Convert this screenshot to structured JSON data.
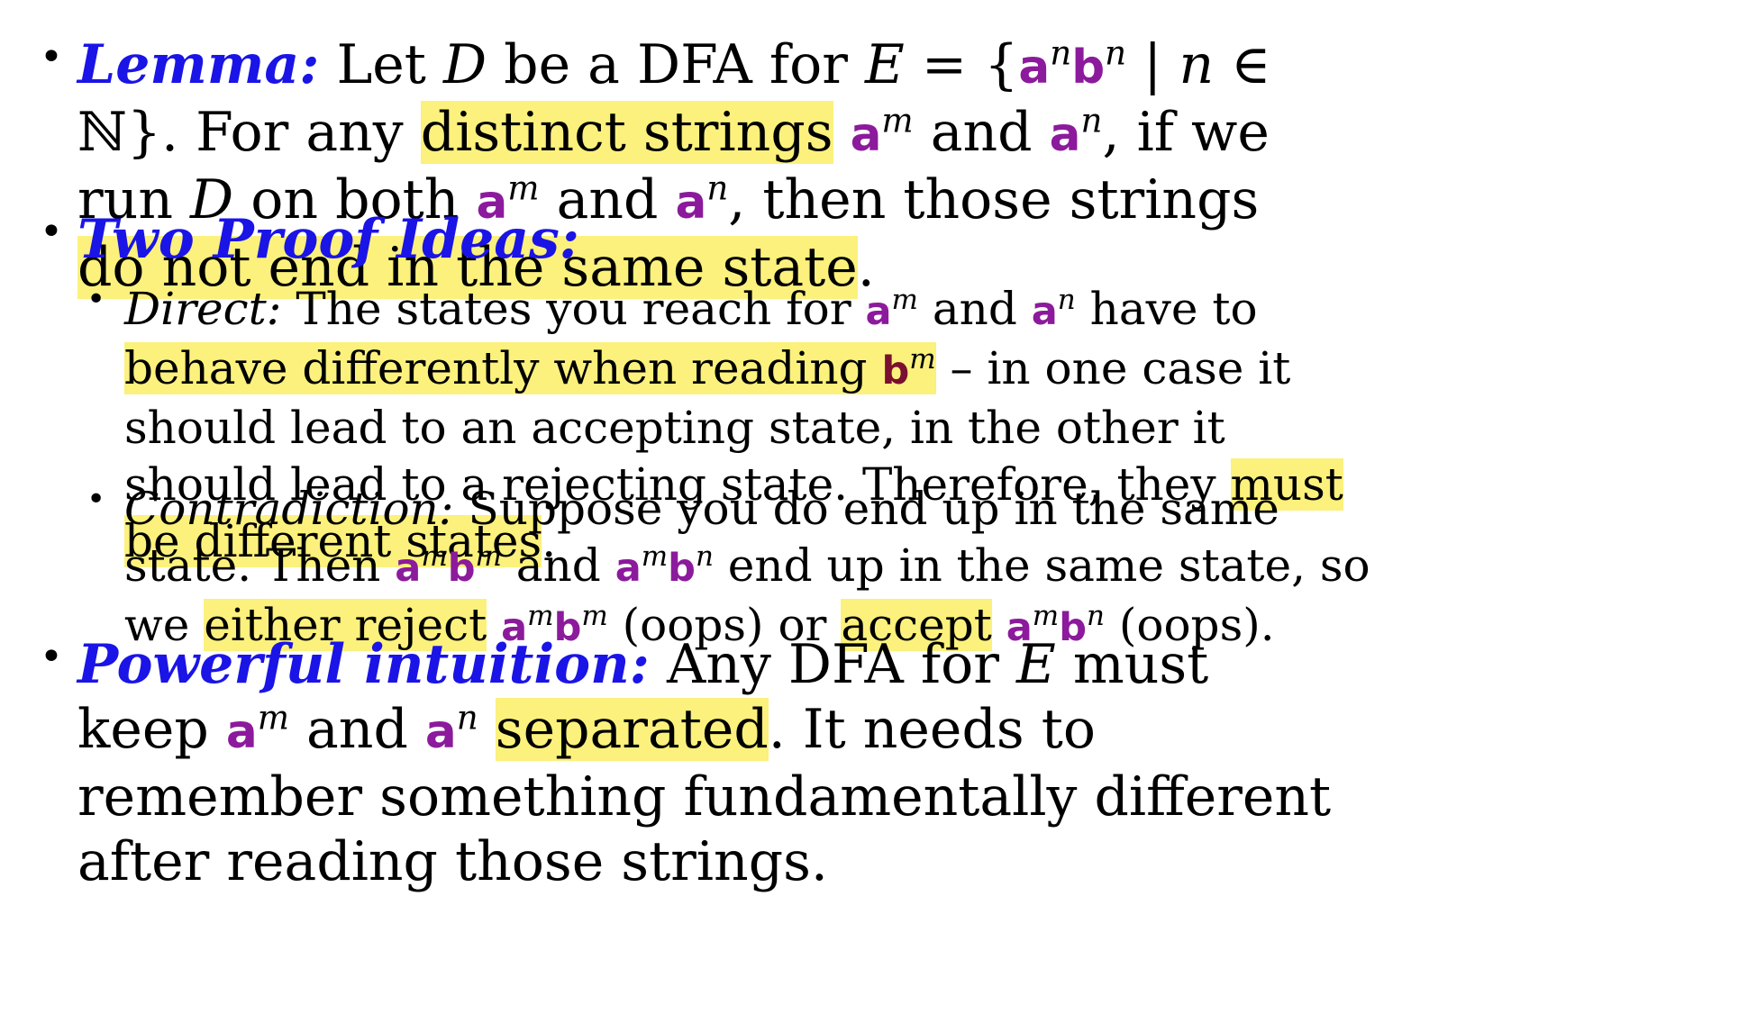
{
  "lemma": {
    "label": "Lemma:",
    "t1": "Let ",
    "D": "D",
    "t2": " be a DFA for ",
    "E": "E",
    "t3": " = {",
    "set_a": "a",
    "set_a_exp": "n",
    "set_b": "b",
    "set_b_exp": "n",
    "t4": " | ",
    "n": "n",
    "t5": " ∈ ℕ}. For any",
    "hl1": "distinct strings",
    "sp1": " ",
    "s1": "a",
    "s1_exp": "m",
    "t6": " and ",
    "s2": "a",
    "s2_exp": "n",
    "t7": ", if we run ",
    "D2": "D",
    "t8": " on both ",
    "s3": "a",
    "s3_exp": "m",
    "t9": " and ",
    "s4": "a",
    "s4_exp": "n",
    "t10": ", then those strings ",
    "hl2": "do not end in the same state",
    "t11": "."
  },
  "proof_ideas": {
    "label": "Two Proof Ideas:",
    "direct": {
      "label": "Direct:",
      "t1": " The states you reach for ",
      "s1": "a",
      "s1_exp": "m",
      "t2": " and ",
      "s2": "a",
      "s2_exp": "n",
      "t3": " have to",
      "hl1": " behave differently when reading ",
      "s3": "b",
      "s3_exp": "m",
      "t4": " – in one case it should lead to an accepting state, in the other it should lead to a rejecting state. Therefore, they ",
      "hl2": "must be different states",
      "t5": "."
    },
    "contradiction": {
      "label": "Contradiction:",
      "t1": " Suppose you do end up in the same state. Then ",
      "a1": "a",
      "a1_exp": "m",
      "b1": "b",
      "b1_exp": "m",
      "t2": " and ",
      "a2": "a",
      "a2_exp": "m",
      "b2": "b",
      "b2_exp": "n",
      "t3": " end up in the same state, so we ",
      "hl1": "either reject",
      "sp1": " ",
      "a3": "a",
      "a3_exp": "m",
      "b3": "b",
      "b3_exp": "m",
      "t4": " (oops) or ",
      "hl2": "accept",
      "sp2": " ",
      "a4": "a",
      "a4_exp": "m",
      "b4": "b",
      "b4_exp": "n",
      "t5": " (oops)."
    }
  },
  "intuition": {
    "label": "Powerful intuition:",
    "t1": " Any DFA for ",
    "E": "E",
    "t2": " must keep ",
    "s1": "a",
    "s1_exp": "m",
    "t3": " and ",
    "s2": "a",
    "s2_exp": "n",
    "t4": " ",
    "hl1": "separated",
    "t5": ". It needs to remember something fundamentally different after reading those strings."
  },
  "bullet_char": "•",
  "colors": {
    "heading_blue": "#1a14e6",
    "symbol_purple": "#8c1a9c",
    "symbol_dark": "#7a1030",
    "highlight": "#fbf17c"
  }
}
